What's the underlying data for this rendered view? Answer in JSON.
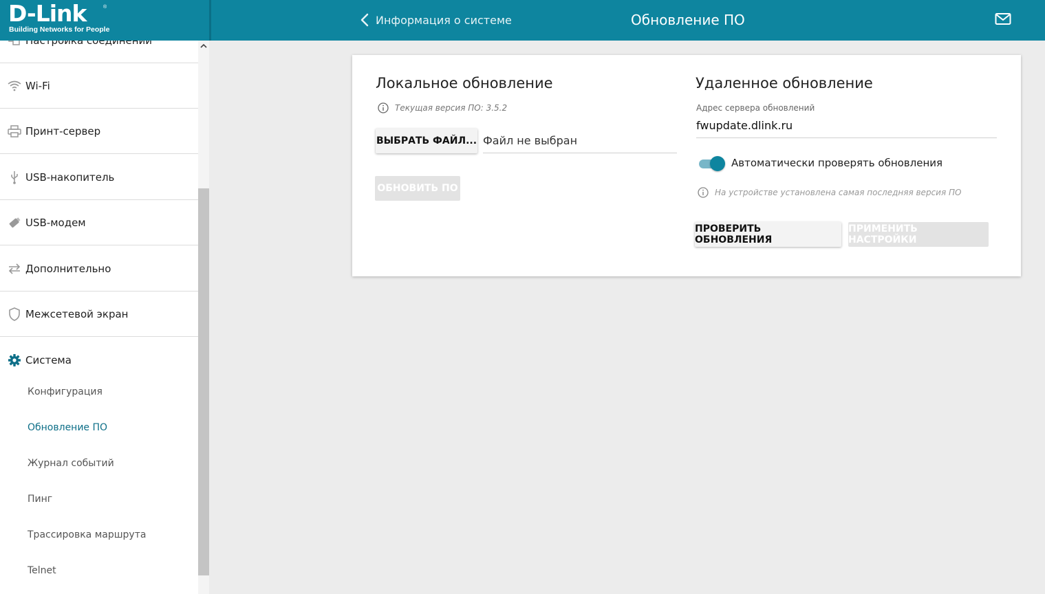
{
  "header": {
    "logo": "D-Link",
    "logo_tagline": "Building Networks for People",
    "back_label": "Информация о системе",
    "page_title": "Обновление ПО"
  },
  "sidebar": {
    "items": [
      {
        "label": "Настройка соединений",
        "icon": "connections-icon"
      },
      {
        "label": "Wi-Fi",
        "icon": "wifi-icon"
      },
      {
        "label": "Принт-сервер",
        "icon": "printer-icon"
      },
      {
        "label": "USB-накопитель",
        "icon": "usb-icon"
      },
      {
        "label": "USB-модем",
        "icon": "usb-modem-icon"
      },
      {
        "label": "Дополнительно",
        "icon": "arrows-icon"
      },
      {
        "label": "Межсетевой экран",
        "icon": "shield-icon"
      },
      {
        "label": "Система",
        "icon": "gear-icon"
      }
    ],
    "system_subitems": [
      "Конфигурация",
      "Обновление ПО",
      "Журнал событий",
      "Пинг",
      "Трассировка маршрута",
      "Telnet"
    ],
    "active_subitem": "Обновление ПО"
  },
  "local": {
    "title": "Локальное обновление",
    "current_version": "Текущая версия ПО: 3.5.2",
    "choose_file_button": "ВЫБРАТЬ ФАЙЛ...",
    "file_status": "Файл не выбран",
    "update_button": "ОБНОВИТЬ ПО"
  },
  "remote": {
    "title": "Удаленное обновление",
    "server_label": "Адрес сервера обновлений",
    "server_value": "fwupdate.dlink.ru",
    "auto_check_label": "Автоматически проверять обновления",
    "auto_check_enabled": true,
    "status_info": "На устройстве установлена самая последняя версия ПО",
    "check_button": "ПРОВЕРИТЬ ОБНОВЛЕНИЯ",
    "apply_button": "ПРИМЕНИТЬ НАСТРОЙКИ"
  },
  "colors": {
    "brand": "#0e859f",
    "active_link": "#0e6f88"
  }
}
